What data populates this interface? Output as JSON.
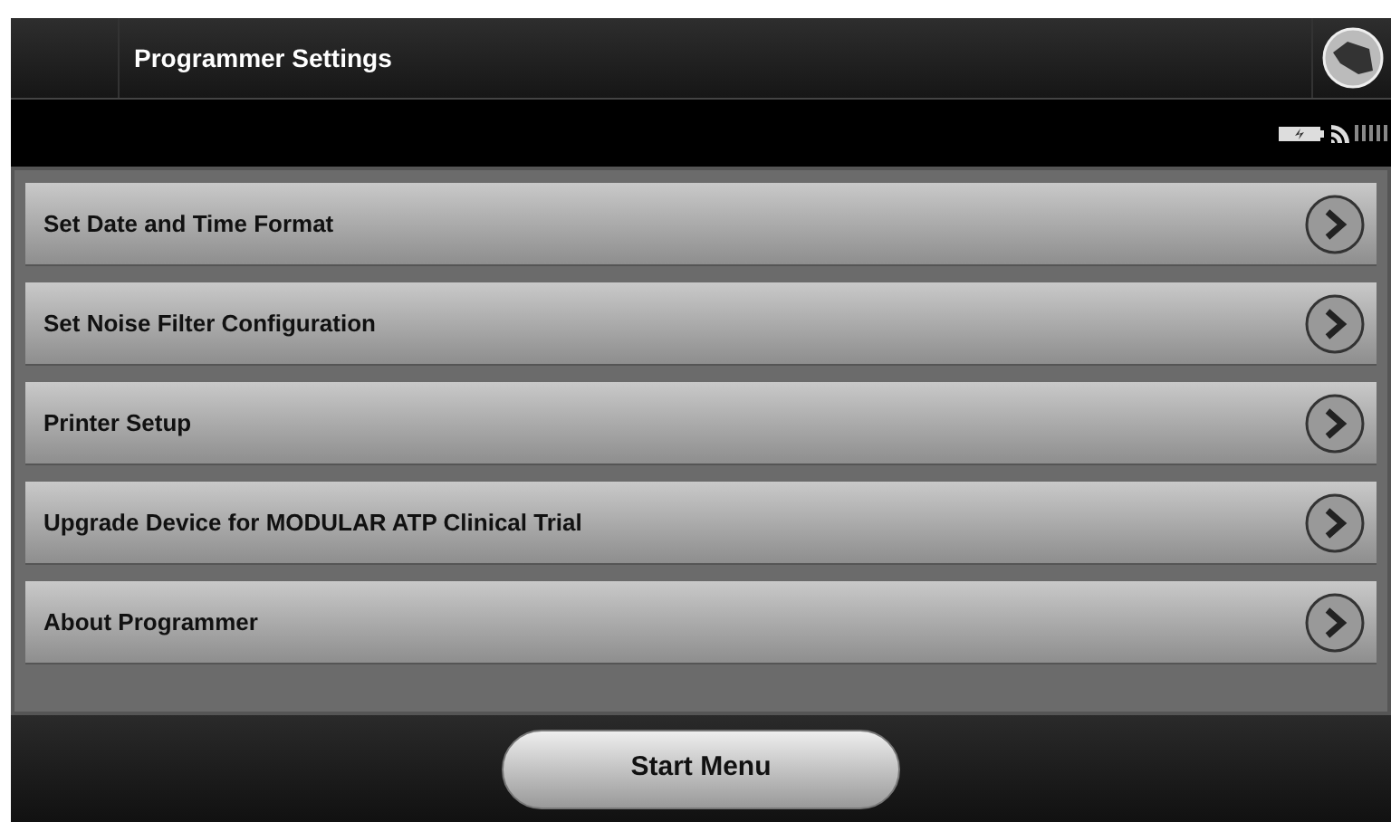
{
  "header": {
    "title": "Programmer Settings"
  },
  "menu_items": [
    {
      "label": "Set Date and Time Format"
    },
    {
      "label": "Set Noise Filter Configuration"
    },
    {
      "label": "Printer Setup"
    },
    {
      "label": "Upgrade Device for MODULAR ATP Clinical Trial"
    },
    {
      "label": "About Programmer"
    }
  ],
  "footer": {
    "button": "Start Menu"
  }
}
